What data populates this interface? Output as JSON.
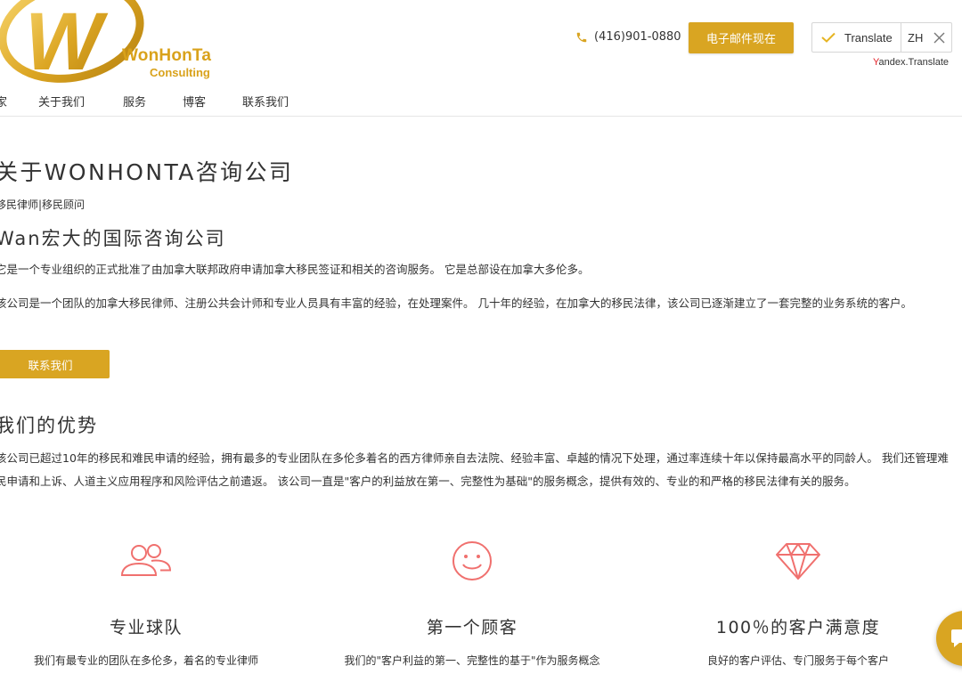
{
  "brand": {
    "name": "WonHonTa",
    "sub": "Consulting",
    "logo_letter": "W"
  },
  "header": {
    "phone": "(416)901-0880",
    "email_button": "电子邮件现在",
    "translate_label": "Translate",
    "translate_lang": "ZH",
    "yandex_first": "Y",
    "yandex_rest": "andex.Translate"
  },
  "nav": {
    "items": [
      "家",
      "关于我们",
      "服务",
      "博客",
      "联系我们"
    ]
  },
  "about": {
    "title": "关于WONHONTA咨询公司",
    "tagline": "移民律师|移民顾问",
    "subtitle": "Wan宏大的国际咨询公司",
    "para1": "它是一个专业组织的正式批准了由加拿大联邦政府申请加拿大移民签证和相关的咨询服务。 它是总部设在加拿大多伦多。",
    "para2": "该公司是一个团队的加拿大移民律师、注册公共会计师和专业人员具有丰富的经验，在处理案件。 几十年的经验，在加拿大的移民法律，该公司已逐渐建立了一套完整的业务系统的客户。",
    "cta": "联系我们"
  },
  "advantages": {
    "title": "我们的优势",
    "para": "该公司已超过10年的移民和难民申请的经验，拥有最多的专业团队在多伦多着名的西方律师亲自去法院、经验丰富、卓越的情况下处理，通过率连续十年以保持最高水平的同龄人。 我们还管理难民申请和上诉、人道主义应用程序和风险评估之前遣返。 该公司一直是\"客户的利益放在第一、完整性为基础\"的服务概念，提供有效的、专业的和严格的移民法律有关的服务。",
    "features": [
      {
        "icon": "team-icon",
        "title": "专业球队",
        "desc": "我们有最专业的团队在多伦多，着名的专业律师"
      },
      {
        "icon": "smiley-icon",
        "title": "第一个顾客",
        "desc": "我们的\"客户利益的第一、完整性的基于\"作为服务概念"
      },
      {
        "icon": "diamond-icon",
        "title": "100％的客户满意度",
        "desc": "良好的客户评估、专门服务于每个客户"
      }
    ]
  },
  "colors": {
    "accent": "#d9a522",
    "icon_accent": "#f0706e",
    "text": "#333333"
  }
}
